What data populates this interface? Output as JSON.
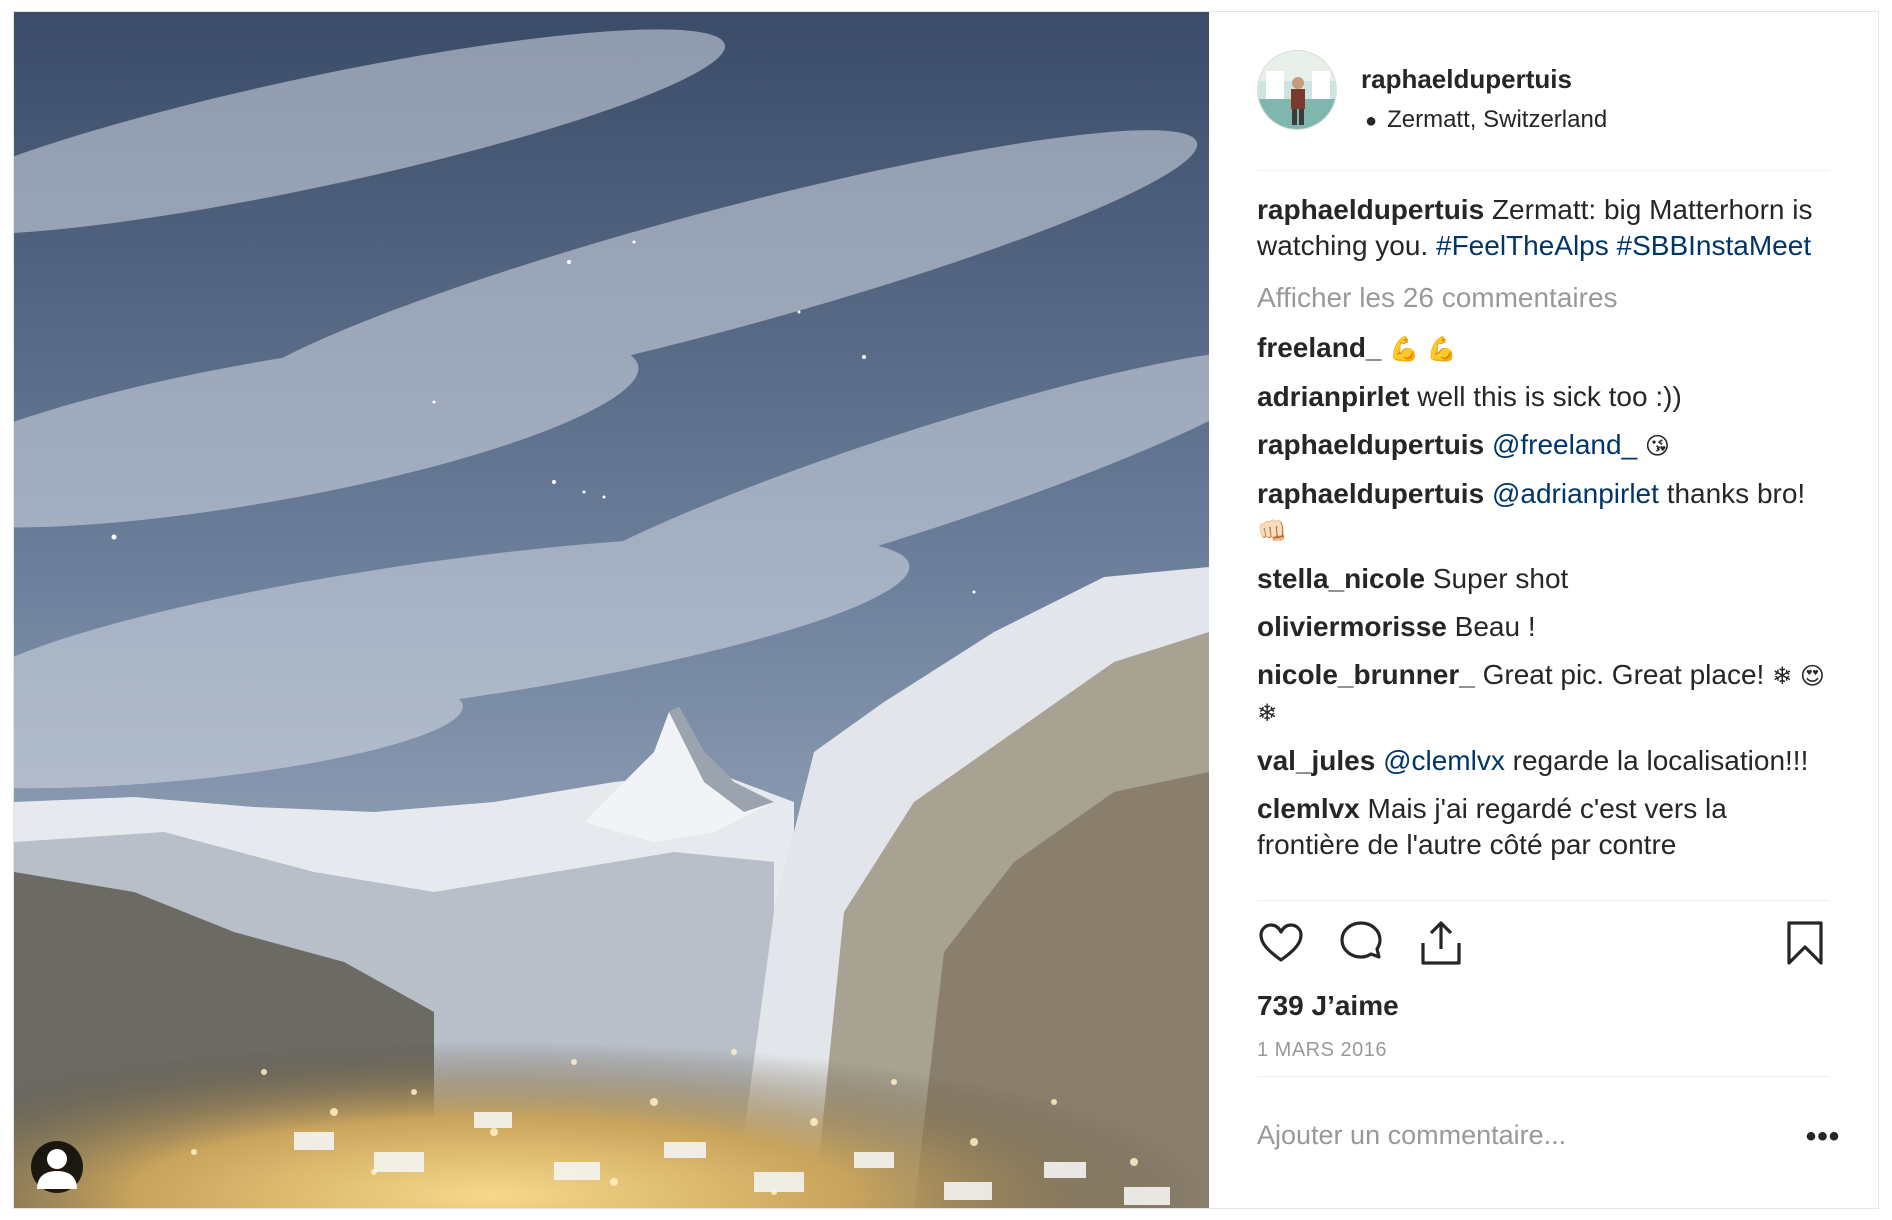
{
  "post": {
    "username": "raphaeldupertuis",
    "location": "Zermatt, Switzerland",
    "caption": {
      "user": "raphaeldupertuis",
      "text": "Zermatt: big Matterhorn is watching you.",
      "hashtag1": "#FeelTheAlps",
      "hashtag2": "#SBBInstaMeet"
    },
    "view_all_comments": "Afficher les 26 commentaires",
    "comments": [
      {
        "user": "freeland_",
        "emoji": "💪 💪"
      },
      {
        "user": "adrianpirlet",
        "text": "well this is sick too :))"
      },
      {
        "user": "raphaeldupertuis",
        "mention": "@freeland_",
        "emoji": "😘"
      },
      {
        "user": "raphaeldupertuis",
        "mention": "@adrianpirlet",
        "text": "thanks bro!",
        "emoji": "👊🏻"
      },
      {
        "user": "stella_nicole",
        "text": "Super shot"
      },
      {
        "user": "oliviermorisse",
        "text": "Beau !"
      },
      {
        "user": "nicole_brunner_",
        "text": "Great pic. Great place!",
        "emoji": "❄ 😍 ❄"
      },
      {
        "user": "val_jules",
        "mention": "@clemlvx",
        "text": "regarde la localisation!!!"
      },
      {
        "user": "clemlvx",
        "text": "Mais j'ai regardé c'est vers la frontière de l'autre côté par contre"
      }
    ],
    "likes": "739 J’aime",
    "date": "1 MARS 2016",
    "add_comment_placeholder": "Ajouter un commentaire...",
    "more_label": "•••",
    "icons": {
      "like": "heart-icon",
      "comment": "comment-bubble-icon",
      "share": "share-icon",
      "save": "bookmark-icon",
      "tagged": "person-tag-icon"
    },
    "colors": {
      "link": "#003569",
      "muted": "#999999",
      "text": "#262626"
    }
  }
}
